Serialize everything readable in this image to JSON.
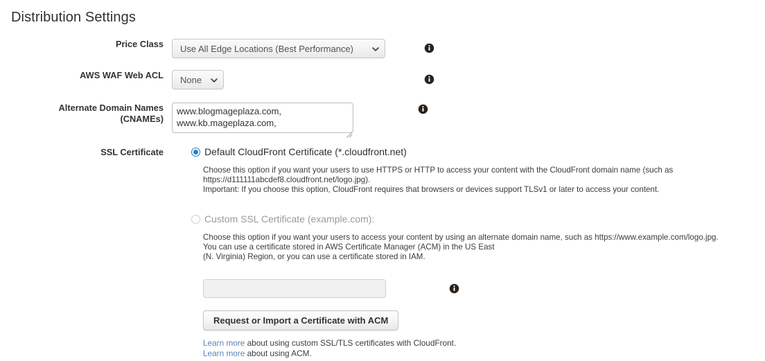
{
  "page": {
    "title": "Distribution Settings"
  },
  "colors": {
    "link": "#5b85b5",
    "radio_selected": "#1f7fd4",
    "label_text": "#333333",
    "disabled_text": "#9a9a9a",
    "background": "#ffffff"
  },
  "rows": {
    "price_class": {
      "label": "Price Class",
      "selected": "Use All Edge Locations (Best Performance)",
      "info_icon": "info-circle-icon",
      "chevron_icon": "chevron-down-icon"
    },
    "waf_web_acl": {
      "label": "AWS WAF Web ACL",
      "selected": "None",
      "info_icon": "info-circle-icon",
      "chevron_icon": "chevron-down-icon"
    },
    "cnames": {
      "label_line1": "Alternate Domain Names",
      "label_line2": "(CNAMEs)",
      "value": "www.blogmageplaza.com,\nwww.kb.mageplaza.com,",
      "placeholder": "",
      "info_icon": "info-circle-icon",
      "resize_icon": "resize-grip-icon"
    },
    "ssl_certificate": {
      "label": "SSL Certificate"
    }
  },
  "ssl_options": {
    "default_cert": {
      "radio_icon": "radio-selected-icon",
      "checked": true,
      "label": "Default CloudFront Certificate (*.cloudfront.net)",
      "description_lines": [
        "Choose this option if you want your users to use HTTPS or HTTP to access your content with the CloudFront domain name (such as",
        "https://d111111abcdef8.cloudfront.net/logo.jpg).",
        "Important: If you choose this option, CloudFront requires that browsers or devices support TLSv1 or later to access your content."
      ]
    },
    "custom_cert": {
      "radio_icon": "radio-unselected-icon",
      "checked": false,
      "disabled": true,
      "label": "Custom SSL Certificate (example.com):",
      "description_lines": [
        "Choose this option if you want your users to access your content by using an alternate domain name, such as https://www.example.com/logo.jpg.",
        "You can use a certificate stored in AWS Certificate Manager (ACM) in the US East",
        "(N. Virginia) Region, or you can use a certificate stored in IAM."
      ]
    }
  },
  "certificate_picker": {
    "value": "",
    "placeholder": "",
    "disabled": true,
    "info_icon": "info-circle-icon"
  },
  "acm_button": {
    "label": "Request or Import a Certificate with ACM"
  },
  "learn_more_links": [
    {
      "link_text": "Learn more",
      "rest_text": " about using custom SSL/TLS certificates with CloudFront."
    },
    {
      "link_text": "Learn more",
      "rest_text": " about using ACM."
    }
  ]
}
